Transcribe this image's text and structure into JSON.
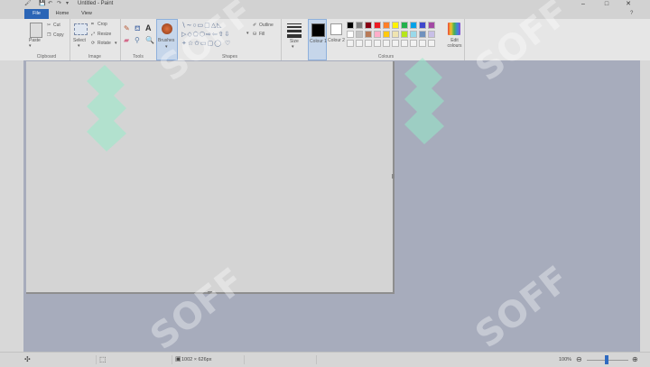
{
  "window": {
    "title": "Untitled - Paint",
    "controls": [
      "–",
      "□",
      "✕"
    ]
  },
  "menu": {
    "tabs": [
      "File",
      "Home",
      "View"
    ]
  },
  "ribbon": {
    "clipboard": {
      "paste": "Paste",
      "cut": "Cut",
      "copy": "Copy",
      "label": "Clipboard"
    },
    "image": {
      "select": "Select",
      "crop": "Crop",
      "resize": "Resize",
      "rotate": "Rotate",
      "label": "Image"
    },
    "tools": {
      "label": "Tools"
    },
    "brushes": {
      "label": "Brushes"
    },
    "shapes": {
      "outline": "Outline",
      "fill": "Fill",
      "label": "Shapes"
    },
    "size": {
      "label": "Size"
    },
    "colour1": {
      "label": "Colour 1"
    },
    "colour2": {
      "label": "Colour 2"
    },
    "edit_colours": {
      "label": "Edit colours"
    },
    "colours": {
      "label": "Colours"
    },
    "palette_row1": [
      "#000000",
      "#7f7f7f",
      "#880015",
      "#ed1c24",
      "#ff7f27",
      "#fff200",
      "#22b14c",
      "#00a2e8",
      "#3f48cc",
      "#a349a4"
    ],
    "palette_row2": [
      "#ffffff",
      "#c3c3c3",
      "#b97a57",
      "#ffaec9",
      "#ffc90e",
      "#efe4b0",
      "#b5e61d",
      "#99d9ea",
      "#7092be",
      "#c8bfe7"
    ]
  },
  "status": {
    "dimensions": "1002 × 626px",
    "zoom": "100%"
  },
  "watermark": "SOFF"
}
